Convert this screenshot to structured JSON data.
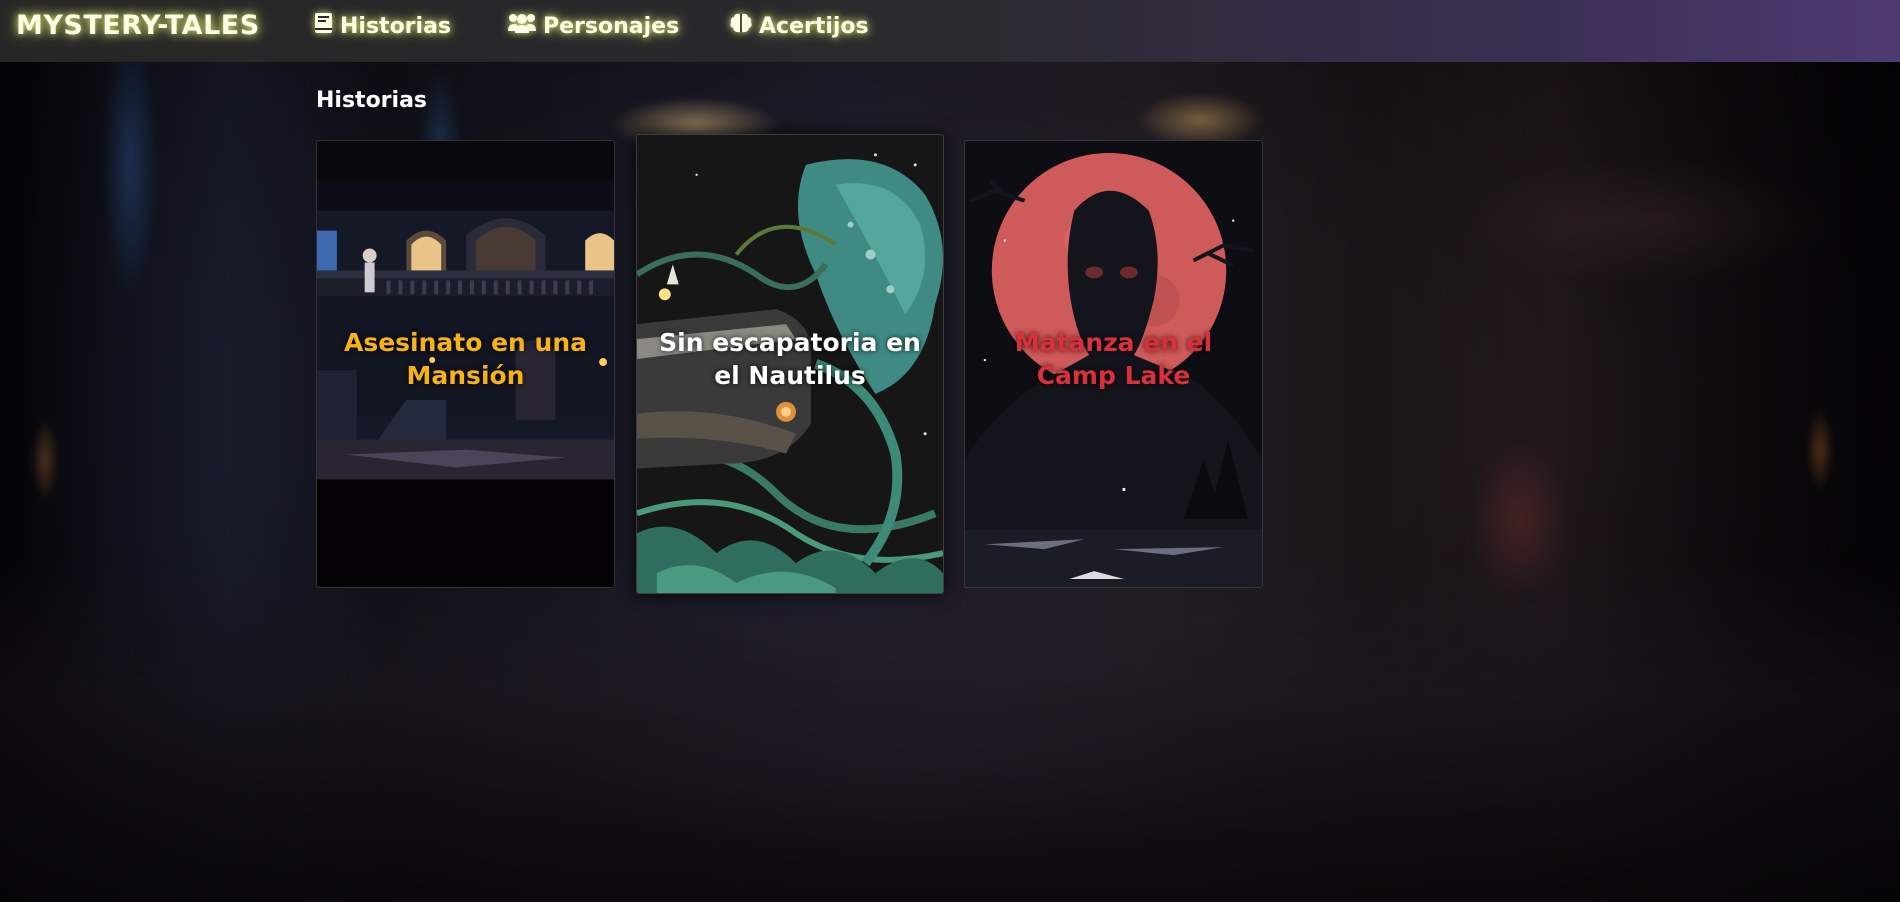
{
  "brand": "MYSTERY-TALES",
  "nav": {
    "historias": {
      "label": "Historias",
      "icon": "book-icon"
    },
    "personajes": {
      "label": "Personajes",
      "icon": "users-icon"
    },
    "acertijos": {
      "label": "Acertijos",
      "icon": "brain-icon"
    }
  },
  "section_title": "Historias",
  "stories": [
    {
      "title": "Asesinato en una Mansión",
      "color": "#f7b21a"
    },
    {
      "title": "Sin escapatoria en el Nautilus",
      "color": "#ffffff"
    },
    {
      "title": "Matanza en el Camp Lake",
      "color": "#d9303c"
    }
  ]
}
